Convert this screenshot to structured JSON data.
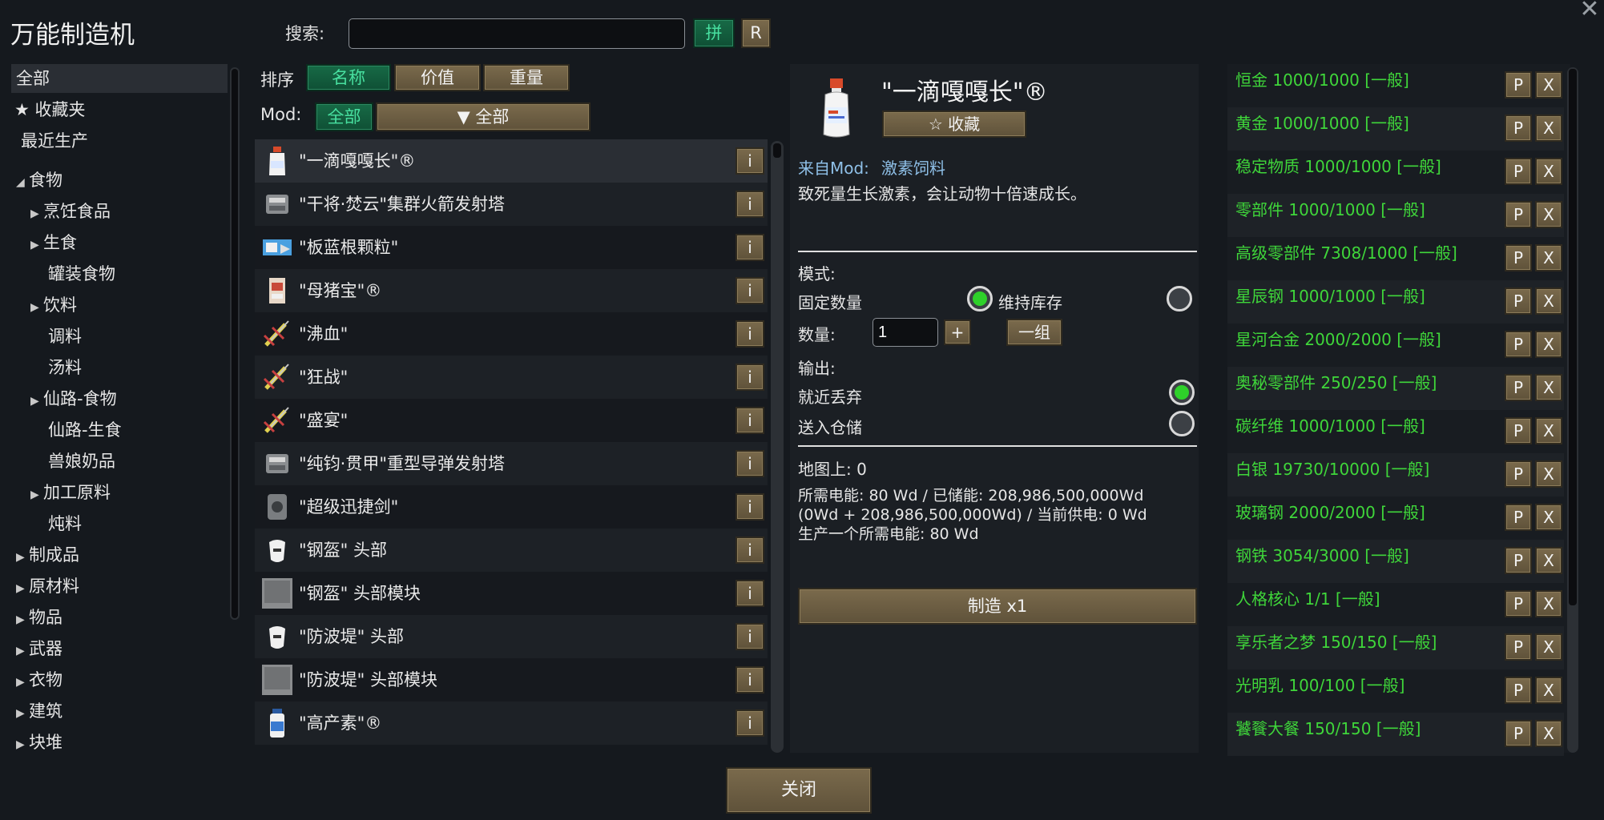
{
  "window": {
    "title": "万能制造机",
    "close_glyph": "✕"
  },
  "search": {
    "label": "搜索:",
    "value": "",
    "placeholder": "",
    "pinyin_label": "拼",
    "reset_label": "R"
  },
  "categories": [
    {
      "label": "全部",
      "level": 0,
      "arrow": "",
      "selected": true
    },
    {
      "label": "★ 收藏夹",
      "level": 0,
      "arrow": ""
    },
    {
      "label": "最近生产",
      "level": 0,
      "arrow": ""
    },
    {
      "label": "食物",
      "level": 0,
      "arrow": "◢"
    },
    {
      "label": "烹饪食品",
      "level": 1,
      "arrow": "▶"
    },
    {
      "label": "生食",
      "level": 1,
      "arrow": "▶"
    },
    {
      "label": "罐装食物",
      "level": 2,
      "arrow": ""
    },
    {
      "label": "饮料",
      "level": 1,
      "arrow": "▶"
    },
    {
      "label": "调料",
      "level": 2,
      "arrow": ""
    },
    {
      "label": "汤料",
      "level": 2,
      "arrow": ""
    },
    {
      "label": "仙路-食物",
      "level": 1,
      "arrow": "▶"
    },
    {
      "label": "仙路-生食",
      "level": 2,
      "arrow": ""
    },
    {
      "label": "兽娘奶品",
      "level": 2,
      "arrow": ""
    },
    {
      "label": "加工原料",
      "level": 1,
      "arrow": "▶"
    },
    {
      "label": "炖料",
      "level": 2,
      "arrow": ""
    },
    {
      "label": "制成品",
      "level": 0,
      "arrow": "▶"
    },
    {
      "label": "原材料",
      "level": 0,
      "arrow": "▶"
    },
    {
      "label": "物品",
      "level": 0,
      "arrow": "▶"
    },
    {
      "label": "武器",
      "level": 0,
      "arrow": "▶"
    },
    {
      "label": "衣物",
      "level": 0,
      "arrow": "▶"
    },
    {
      "label": "建筑",
      "level": 0,
      "arrow": "▶"
    },
    {
      "label": "块堆",
      "level": 0,
      "arrow": "▶"
    }
  ],
  "sort": {
    "label": "排序",
    "buttons": [
      "名称",
      "价值",
      "重量"
    ]
  },
  "mod_filter": {
    "label": "Mod:",
    "all_label": "全部",
    "dropdown_label": "▼ 全部"
  },
  "items": [
    {
      "name": "\"一滴嘎嘎长\"®",
      "icon": "bottle-icon"
    },
    {
      "name": "\"干将·焚云\"集群火箭发射塔",
      "icon": "turret-icon"
    },
    {
      "name": "\"板蓝根颗粒\"",
      "icon": "medicine-box-icon"
    },
    {
      "name": "\"母猪宝\"®",
      "icon": "package-icon"
    },
    {
      "name": "\"沸血\"",
      "icon": "syringe-icon"
    },
    {
      "name": "\"狂战\"",
      "icon": "syringe-icon"
    },
    {
      "name": "\"盛宴\"",
      "icon": "syringe-icon"
    },
    {
      "name": "\"纯钧·贯甲\"重型导弹发射塔",
      "icon": "turret-icon"
    },
    {
      "name": "\"超级迅捷剑\"",
      "icon": "mech-icon"
    },
    {
      "name": "\"钢盔\" 头部",
      "icon": "helmet-icon"
    },
    {
      "name": "\"钢盔\" 头部模块",
      "icon": "module-icon"
    },
    {
      "name": "\"防波堤\" 头部",
      "icon": "helmet-icon"
    },
    {
      "name": "\"防波堤\" 头部模块",
      "icon": "module-icon"
    },
    {
      "name": "\"高产素\"®",
      "icon": "vial-icon"
    }
  ],
  "info_button_label": "i",
  "detail": {
    "title": "\"一滴嘎嘎长\"®",
    "favorite_label": "☆ 收藏",
    "mod_source_prefix": "来自Mod:",
    "mod_source_name": "激素饲料",
    "description": "致死量生长激素，会让动物十倍速成长。",
    "mode_label": "模式:",
    "fixed_qty_label": "固定数量",
    "keep_stock_label": "维持库存",
    "qty_label": "数量:",
    "qty_value": "1",
    "plus_label": "+",
    "group_label": "一组",
    "output_label": "输出:",
    "drop_nearby_label": "就近丢弃",
    "send_storage_label": "送入仓储",
    "on_map": "地图上: 0",
    "power_line1": "所需电能: 80 Wd / 已储能: 208,986,500,000Wd",
    "power_line2": "(0Wd + 208,986,500,000Wd) / 当前供电: 0 Wd",
    "power_line3": "生产一个所需电能: 80 Wd",
    "craft_label": "制造 x1"
  },
  "stock": [
    "恒金 1000/1000 [一般]",
    "黄金 1000/1000 [一般]",
    "稳定物质 1000/1000 [一般]",
    "零部件 1000/1000 [一般]",
    "高级零部件 7308/1000 [一般]",
    "星辰钢 1000/1000 [一般]",
    "星河合金 2000/2000 [一般]",
    "奥秘零部件 250/250 [一般]",
    "碳纤维 1000/1000 [一般]",
    "白银 19730/10000 [一般]",
    "玻璃钢 2000/2000 [一般]",
    "钢铁 3054/3000 [一般]",
    "人格核心 1/1 [一般]",
    "享乐者之梦 150/150 [一般]",
    "光明乳 100/100 [一般]",
    "饕餮大餐 150/150 [一般]"
  ],
  "stock_p_label": "P",
  "stock_x_label": "X",
  "close_label": "关闭",
  "colors": {
    "accent_green": "#3fd63a",
    "button_brown": "#6e5f44",
    "button_green": "#156046",
    "mod_link": "#8fc0e8"
  }
}
